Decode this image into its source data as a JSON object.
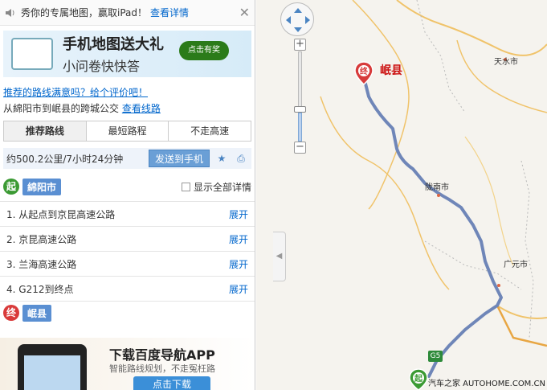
{
  "ad_top": {
    "text": "秀你的专属地图，赢取iPad！",
    "link": "查看详情"
  },
  "promo": {
    "line1": "手机地图送大礼",
    "line2": "小问卷快快答",
    "button": "点击有奖"
  },
  "feedback_link": "推荐的路线满意吗？给个评价吧！",
  "transit_line": {
    "text": "从綿阳市到岷县的跨城公交",
    "link": "查看线路"
  },
  "tabs": [
    "推荐路线",
    "最短路程",
    "不走高速"
  ],
  "summary": {
    "distance_time": "约500.2公里/7小时24分钟",
    "send_button": "发送到手机"
  },
  "start": {
    "badge": "起",
    "city": "綿阳市",
    "show_all": "显示全部详情"
  },
  "steps": [
    {
      "text": "1. 从起点到京昆高速公路",
      "action": "展开"
    },
    {
      "text": "2. 京昆高速公路",
      "action": "展开"
    },
    {
      "text": "3. 兰海高速公路",
      "action": "展开"
    },
    {
      "text": "4. G212到终点",
      "action": "展开"
    }
  ],
  "end": {
    "badge": "终",
    "city": "岷县"
  },
  "app_promo": {
    "title": "下载百度导航APP",
    "subtitle": "智能路线规划，不走冤枉路",
    "button": "点击下载"
  },
  "map": {
    "end_label": "岷县",
    "cities": [
      "天水市",
      "陇南市",
      "广元市"
    ],
    "road_shield": "G5",
    "watermark": "汽车之家 AUTOHOME.COM.CN",
    "route_color": "#6f86b8"
  }
}
